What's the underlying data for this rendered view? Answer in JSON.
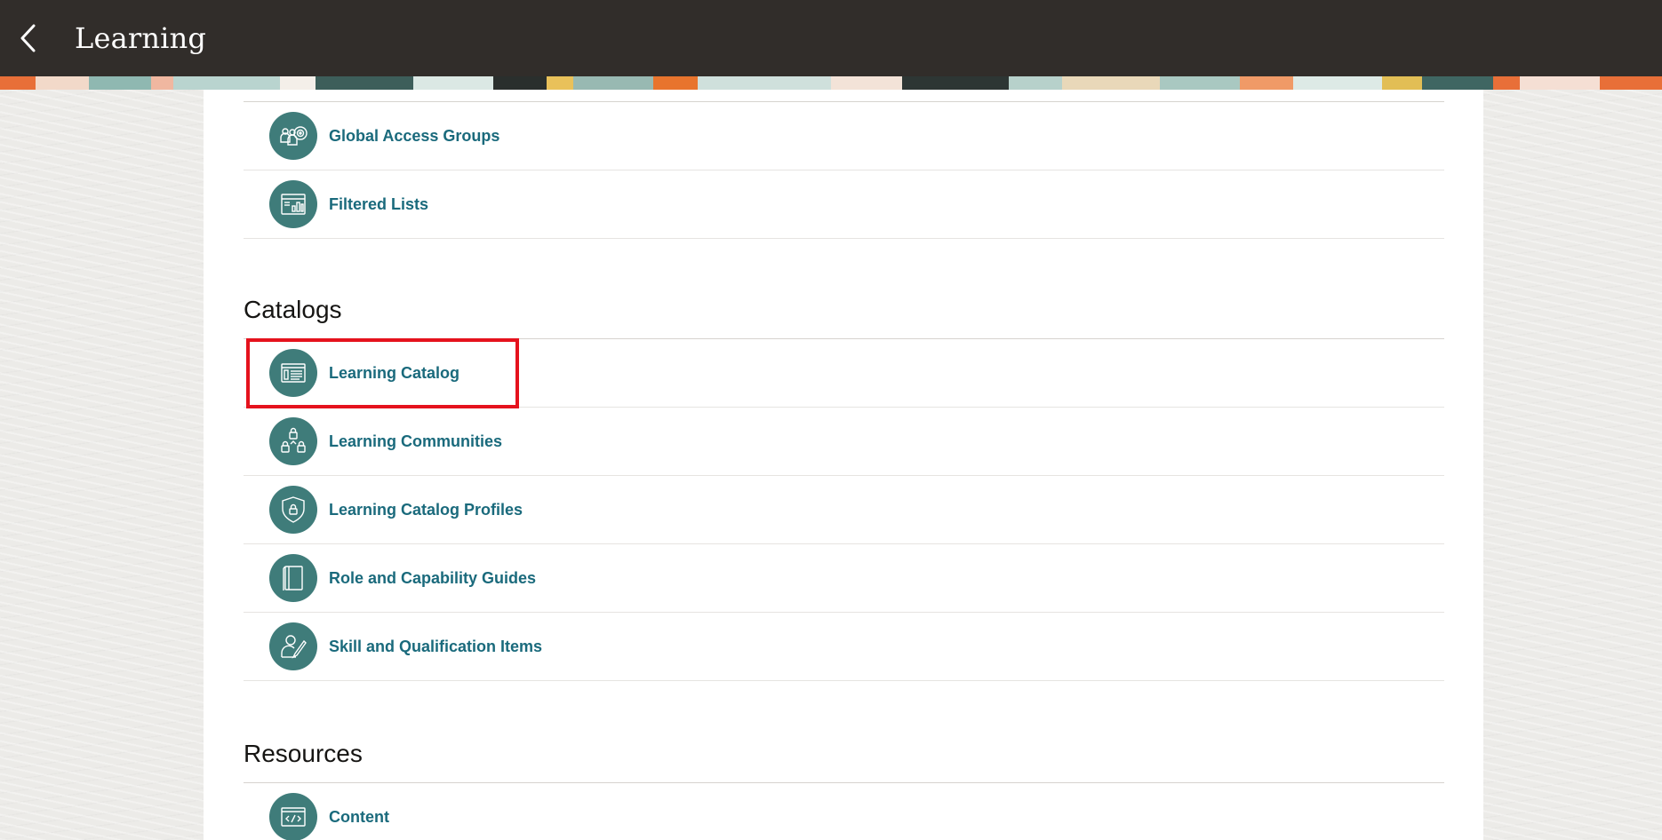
{
  "header": {
    "title": "Learning",
    "back_icon": "chevron-left-icon"
  },
  "colors": {
    "header_bg": "#312d2a",
    "icon_bg": "#3f7c7a",
    "link": "#1a6a7c",
    "highlight": "#e5121d"
  },
  "top_items": [
    {
      "label": "Global Access Groups",
      "icon": "access-groups-icon"
    },
    {
      "label": "Filtered Lists",
      "icon": "filtered-list-icon"
    }
  ],
  "catalogs": {
    "title": "Catalogs",
    "items": [
      {
        "label": "Learning Catalog",
        "icon": "catalog-icon"
      },
      {
        "label": "Learning Communities",
        "icon": "communities-icon"
      },
      {
        "label": "Learning Catalog Profiles",
        "icon": "shield-lock-icon"
      },
      {
        "label": "Role and Capability Guides",
        "icon": "guide-book-icon"
      },
      {
        "label": "Skill and Qualification Items",
        "icon": "skill-person-icon"
      }
    ]
  },
  "resources": {
    "title": "Resources",
    "items": [
      {
        "label": "Content",
        "icon": "code-window-icon"
      }
    ]
  }
}
